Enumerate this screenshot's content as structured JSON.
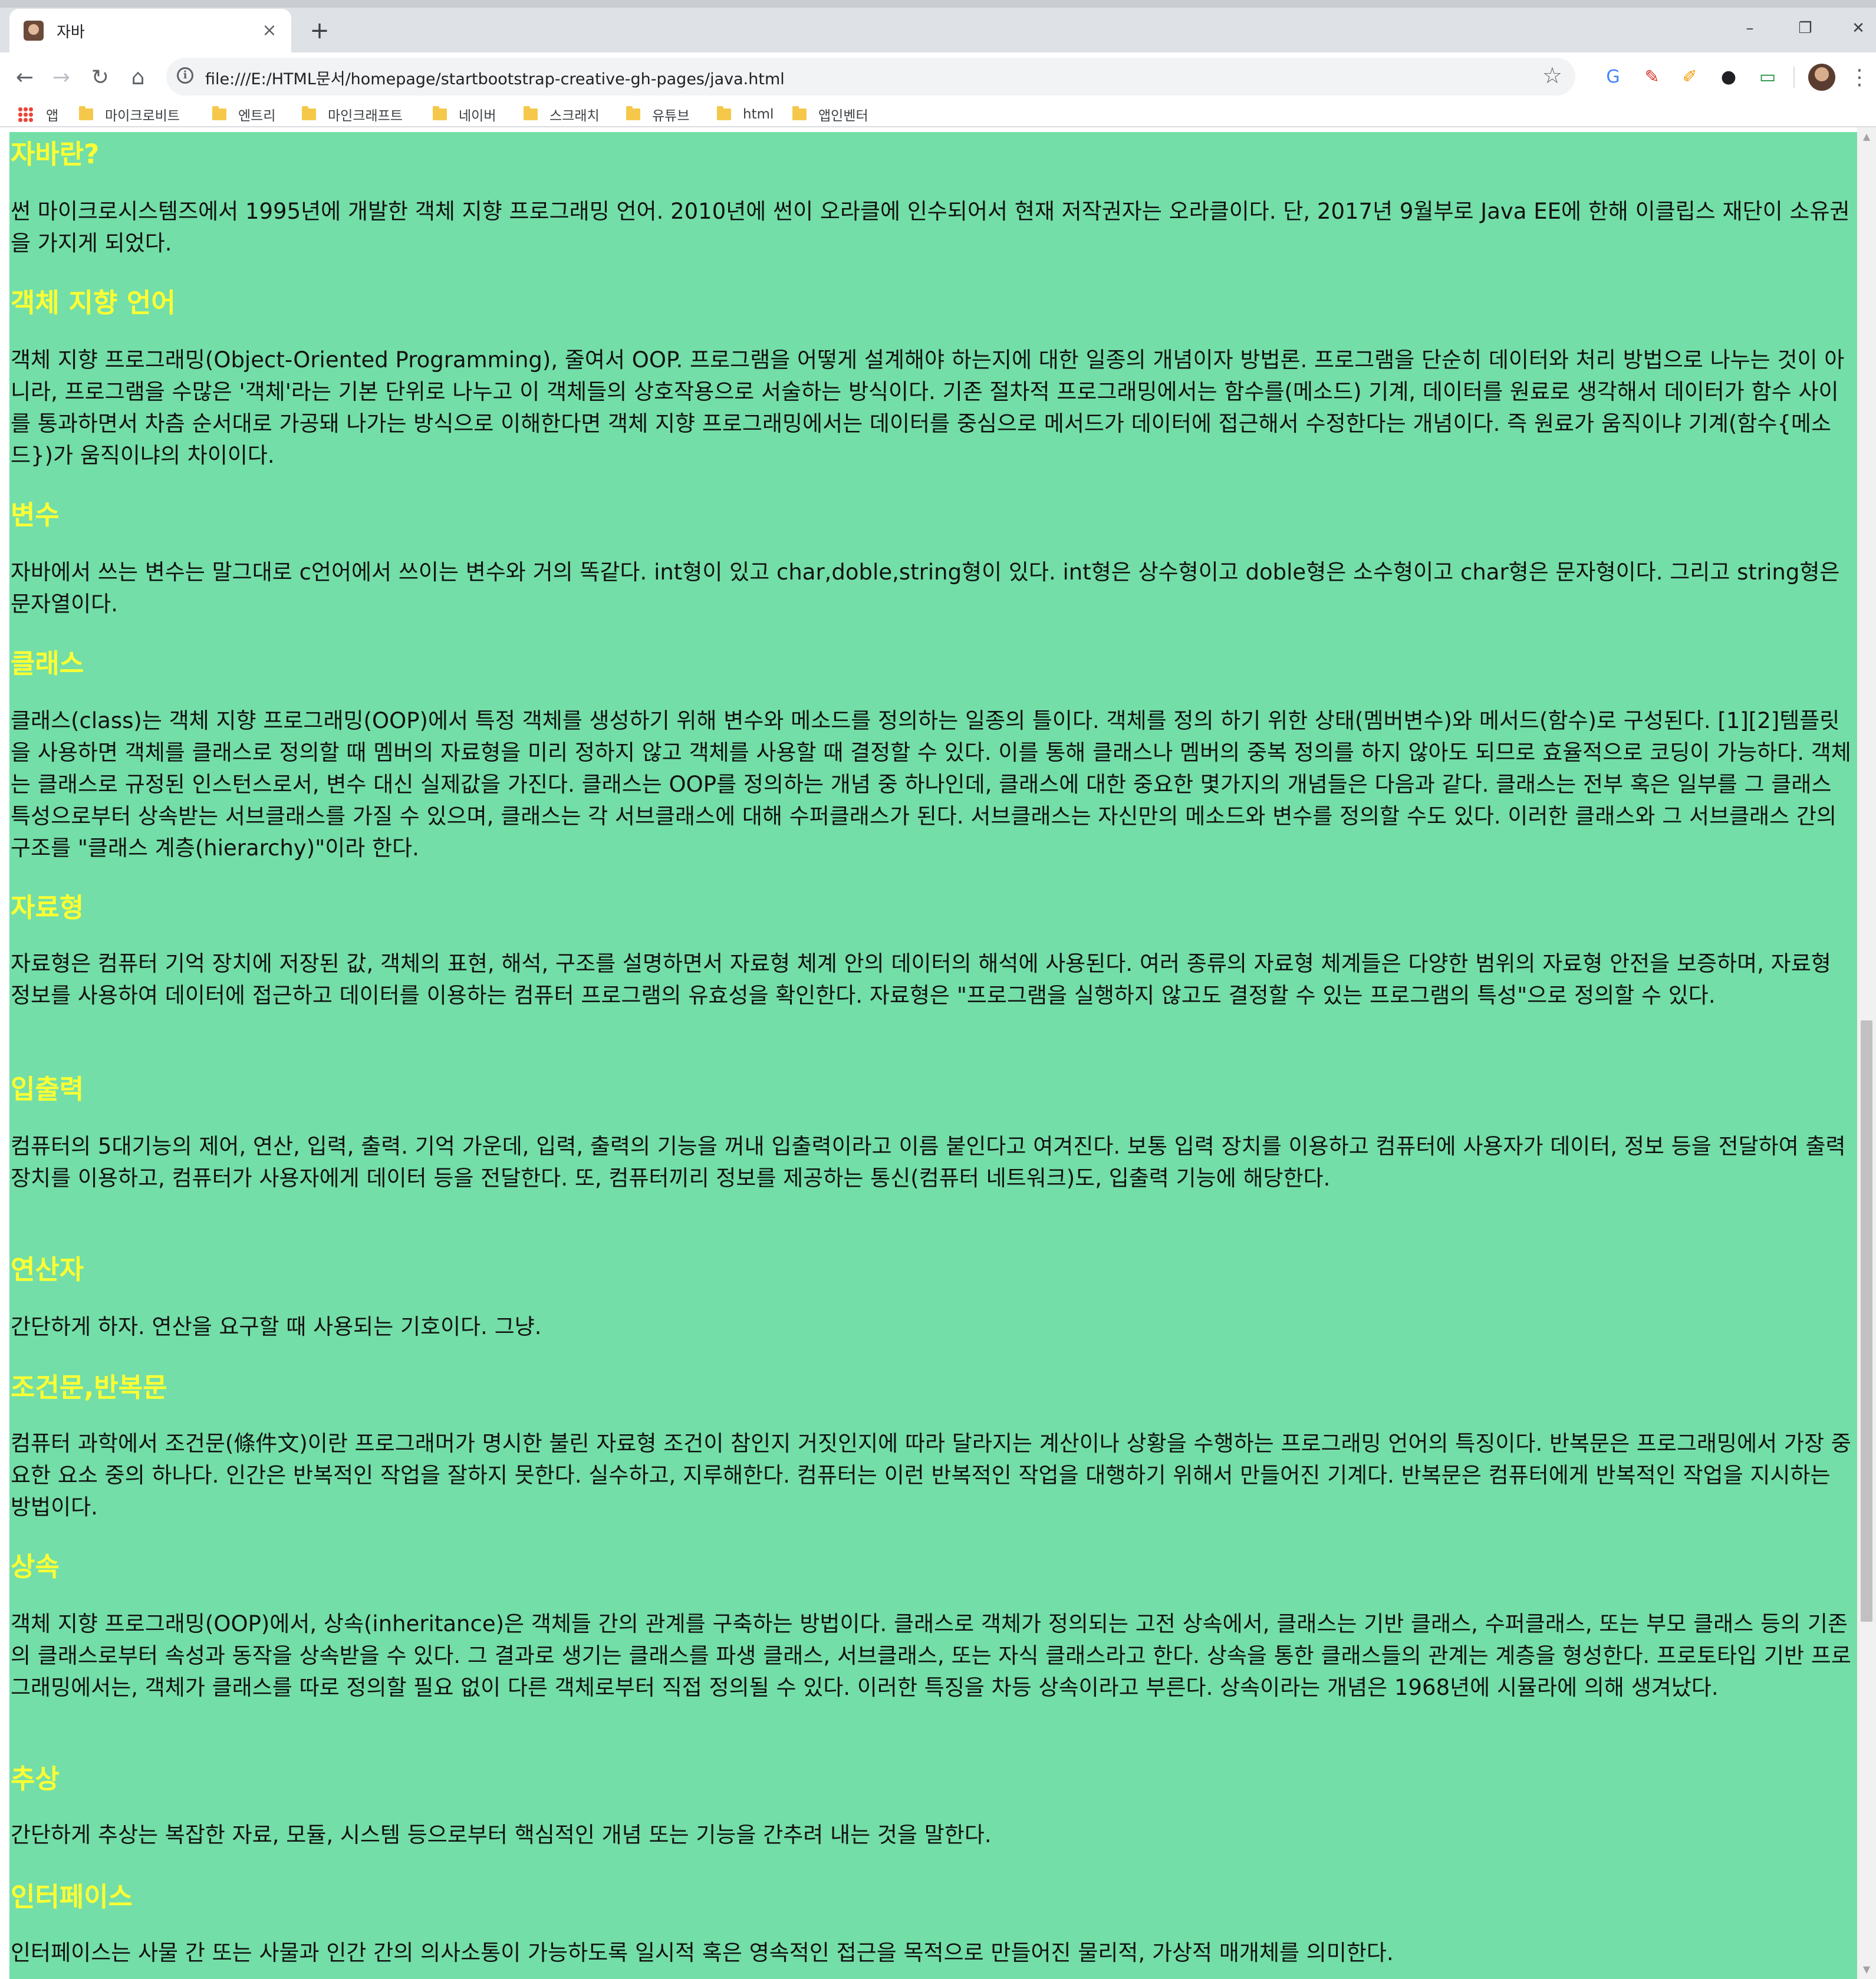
{
  "browser": {
    "tab_title": "자바",
    "tab_close": "×",
    "new_tab": "+",
    "minimize": "–",
    "restore": "❐",
    "close": "✕",
    "back": "←",
    "forward": "→",
    "reload": "↻",
    "home": "⌂",
    "url": "file:///E:/HTML문서/homepage/startbootstrap-creative-gh-pages/java.html",
    "star": "☆",
    "menu": "⋮"
  },
  "bookmarks": [
    {
      "label": "앱"
    },
    {
      "label": "마이크로비트"
    },
    {
      "label": "엔트리"
    },
    {
      "label": "마인크래프트"
    },
    {
      "label": "네이버"
    },
    {
      "label": "스크래치"
    },
    {
      "label": "유튜브"
    },
    {
      "label": "html"
    },
    {
      "label": "앱인벤터"
    }
  ],
  "colors": {
    "page_background": "#73dea7",
    "heading": "#ffff33",
    "body_text": "#111111"
  },
  "sections": [
    {
      "heading": "자바란?",
      "text": "썬 마이크로시스템즈에서 1995년에 개발한 객체 지향 프로그래밍 언어. 2010년에 썬이 오라클에 인수되어서 현재 저작권자는 오라클이다. 단, 2017년 9월부로 Java EE에 한해 이클립스 재단이 소유권을 가지게 되었다."
    },
    {
      "heading": "객체 지향 언어",
      "text": "객체 지향 프로그래밍(Object-Oriented Programming), 줄여서 OOP. 프로그램을 어떻게 설계해야 하는지에 대한 일종의 개념이자 방법론. 프로그램을 단순히 데이터와 처리 방법으로 나누는 것이 아니라, 프로그램을 수많은 '객체'라는 기본 단위로 나누고 이 객체들의 상호작용으로 서술하는 방식이다. 기존 절차적 프로그래밍에서는 함수를(메소드) 기계, 데이터를 원료로 생각해서 데이터가 함수 사이를 통과하면서 차츰 순서대로 가공돼 나가는 방식으로 이해한다면 객체 지향 프로그래밍에서는 데이터를 중심으로 메서드가 데이터에 접근해서 수정한다는 개념이다. 즉 원료가 움직이냐 기계(함수{메소드})가 움직이냐의 차이이다."
    },
    {
      "heading": "변수",
      "text": "자바에서 쓰는 변수는 말그대로 c언어에서 쓰이는 변수와 거의 똑같다. int형이 있고 char,doble,string형이 있다. int형은 상수형이고 doble형은 소수형이고 char형은 문자형이다. 그리고 string형은 문자열이다."
    },
    {
      "heading": "클래스",
      "text": "클래스(class)는 객체 지향 프로그래밍(OOP)에서 특정 객체를 생성하기 위해 변수와 메소드를 정의하는 일종의 틀이다. 객체를 정의 하기 위한 상태(멤버변수)와 메서드(함수)로 구성된다. [1][2]템플릿을 사용하면 객체를 클래스로 정의할 때 멤버의 자료형을 미리 정하지 않고 객체를 사용할 때 결정할 수 있다. 이를 통해 클래스나 멤버의 중복 정의를 하지 않아도 되므로 효율적으로 코딩이 가능하다. 객체는 클래스로 규정된 인스턴스로서, 변수 대신 실제값을 가진다. 클래스는 OOP를 정의하는 개념 중 하나인데, 클래스에 대한 중요한 몇가지의 개념들은 다음과 같다. 클래스는 전부 혹은 일부를 그 클래스 특성으로부터 상속받는 서브클래스를 가질 수 있으며, 클래스는 각 서브클래스에 대해 수퍼클래스가 된다. 서브클래스는 자신만의 메소드와 변수를 정의할 수도 있다. 이러한 클래스와 그 서브클래스 간의 구조를 \"클래스 계층(hierarchy)\"이라 한다."
    },
    {
      "heading": "자료형",
      "text": "자료형은 컴퓨터 기억 장치에 저장된 값, 객체의 표현, 해석, 구조를 설명하면서 자료형 체계 안의 데이터의 해석에 사용된다. 여러 종류의 자료형 체계들은 다양한 범위의 자료형 안전을 보증하며, 자료형 정보를 사용하여 데이터에 접근하고 데이터를 이용하는 컴퓨터 프로그램의 유효성을 확인한다. 자료형은 \"프로그램을 실행하지 않고도 결정할 수 있는 프로그램의 특성\"으로 정의할 수 있다."
    },
    {
      "heading": "입출력",
      "text": "컴퓨터의 5대기능의 제어, 연산, 입력, 출력. 기억 가운데, 입력, 출력의 기능을 꺼내 입출력이라고 이름 붙인다고 여겨진다. 보통 입력 장치를 이용하고 컴퓨터에 사용자가 데이터, 정보 등을 전달하여 출력 장치를 이용하고, 컴퓨터가 사용자에게 데이터 등을 전달한다. 또, 컴퓨터끼리 정보를 제공하는 통신(컴퓨터 네트워크)도, 입출력 기능에 해당한다."
    },
    {
      "heading": "연산자",
      "text": "간단하게 하자. 연산을 요구할 때 사용되는 기호이다. 그냥."
    },
    {
      "heading": "조건문,반복문",
      "text": "컴퓨터 과학에서 조건문(條件文)이란 프로그래머가 명시한 불린 자료형 조건이 참인지 거짓인지에 따라 달라지는 계산이나 상황을 수행하는 프로그래밍 언어의 특징이다. 반복문은 프로그래밍에서 가장 중요한 요소 중의 하나다. 인간은 반복적인 작업을 잘하지 못한다. 실수하고, 지루해한다. 컴퓨터는 이런 반복적인 작업을 대행하기 위해서 만들어진 기계다. 반복문은 컴퓨터에게 반복적인 작업을 지시하는 방법이다."
    },
    {
      "heading": "상속",
      "text": "객체 지향 프로그래밍(OOP)에서, 상속(inheritance)은 객체들 간의 관계를 구축하는 방법이다. 클래스로 객체가 정의되는 고전 상속에서, 클래스는 기반 클래스, 수퍼클래스, 또는 부모 클래스 등의 기존의 클래스로부터 속성과 동작을 상속받을 수 있다. 그 결과로 생기는 클래스를 파생 클래스, 서브클래스, 또는 자식 클래스라고 한다. 상속을 통한 클래스들의 관계는 계층을 형성한다. 프로토타입 기반 프로그래밍에서는, 객체가 클래스를 따로 정의할 필요 없이 다른 객체로부터 직접 정의될 수 있다. 이러한 특징을 차등 상속이라고 부른다. 상속이라는 개념은 1968년에 시뮬라에 의해 생겨났다."
    },
    {
      "heading": "추상",
      "text": "간단하게 추상는 복잡한 자료, 모듈, 시스템 등으로부터 핵심적인 개념 또는 기능을 간추려 내는 것을 말한다."
    },
    {
      "heading": "인터페이스",
      "text": "인터페이스는 사물 간 또는 사물과 인간 간의 의사소통이 가능하도록 일시적 혹은 영속적인 접근을 목적으로 만들어진 물리적, 가상적 매개체를 의미한다."
    }
  ]
}
